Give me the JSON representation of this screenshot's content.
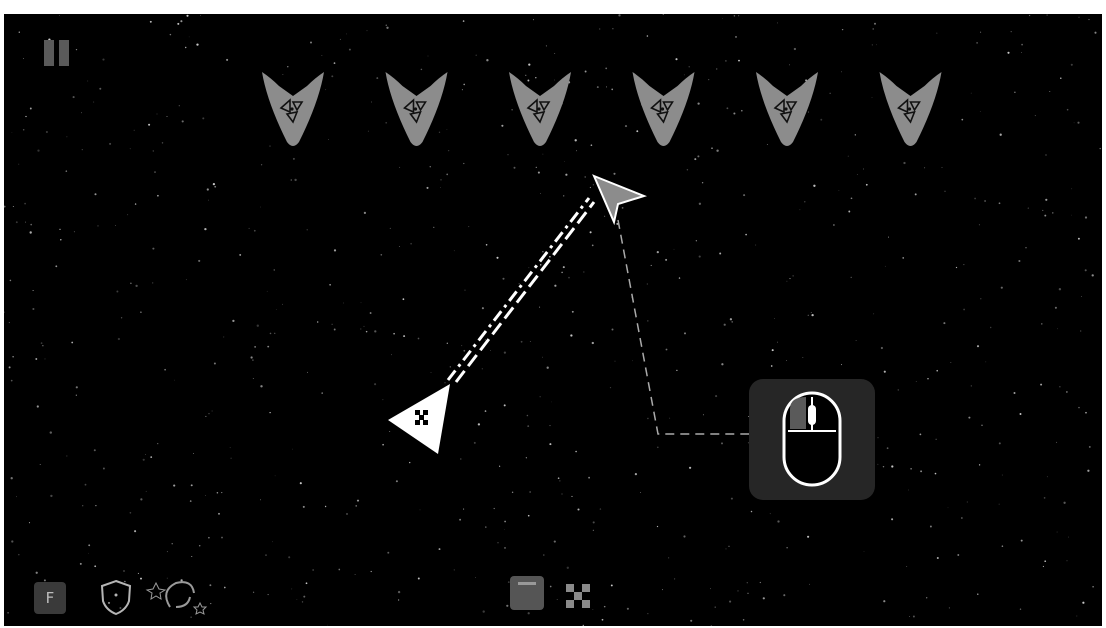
{
  "caption": "",
  "hud": {
    "pause_icon": "pause-icon",
    "bottom_left": [
      {
        "name": "fire-button",
        "label": "F"
      },
      {
        "name": "shield-icon"
      },
      {
        "name": "galaxy-warp-icon"
      }
    ],
    "bottom_center": [
      {
        "name": "menu-square-icon"
      },
      {
        "name": "checker-icon"
      }
    ]
  },
  "enemies": {
    "count": 6,
    "icon": "radiation-chevron-icon",
    "color": "#8c8c8c"
  },
  "player": {
    "icon": "checker-triangle-ship",
    "color": "#ffffff"
  },
  "cursor": {
    "icon": "arrow-cursor-icon",
    "color": "#8c8c8c"
  },
  "tutorial_hint": {
    "icon": "mouse-left-click-icon"
  },
  "colors": {
    "space": "#000000",
    "stars": "#ffffff",
    "hint_panel": "#262626"
  }
}
